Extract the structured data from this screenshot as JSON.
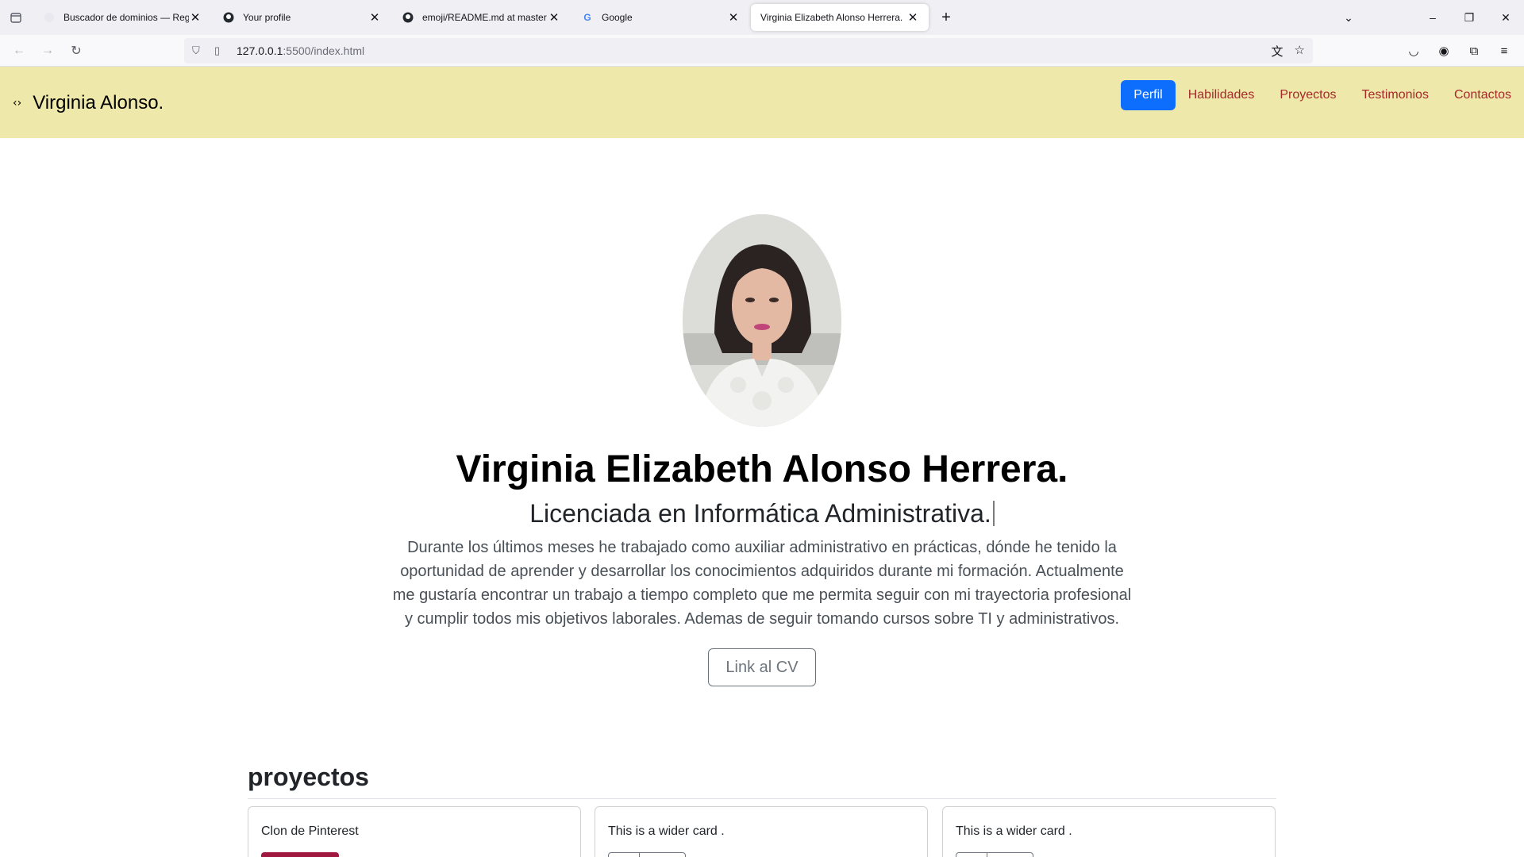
{
  "browser": {
    "tabs": [
      {
        "title": "Buscador de dominios — Regis",
        "icon": "globe-icon",
        "active": false
      },
      {
        "title": "Your profile",
        "icon": "github-icon",
        "active": false
      },
      {
        "title": "emoji/README.md at master · i",
        "icon": "github-icon",
        "active": false
      },
      {
        "title": "Google",
        "icon": "google-icon",
        "active": false
      },
      {
        "title": "Virginia Elizabeth Alonso Herrera.",
        "icon": "",
        "active": true
      }
    ],
    "url_host": "127.0.0.1",
    "url_path": ":5500/index.html"
  },
  "site": {
    "brand_name": "Virginia Alonso.",
    "brand_icon": "code-icon",
    "nav": [
      {
        "label": "Perfil",
        "active": true
      },
      {
        "label": "Habilidades",
        "active": false
      },
      {
        "label": "Proyectos",
        "active": false
      },
      {
        "label": "Testimonios",
        "active": false
      },
      {
        "label": "Contactos",
        "active": false
      }
    ],
    "nav_active_color": "#0d6efd",
    "nav_link_color": "#a52a2a",
    "header_bg": "#eee8aa"
  },
  "hero": {
    "name": "Virginia Elizabeth Alonso Herrera.",
    "subtitle": "Licenciada en Informática Administrativa.",
    "description": "Durante los últimos meses he trabajado como auxiliar administrativo en prácticas, dónde he tenido la oportunidad de aprender y desarrollar los conocimientos adquiridos durante mi formación. Actualmente me gustaría encontrar un trabajo a tiempo completo que me permita seguir con mi trayectoria profesional y cumplir todos mis objetivos laborales. Ademas de seguir tomando cursos sobre TI y administrativos.",
    "cv_button": "Link al CV"
  },
  "projects": {
    "title": "proyectos",
    "cards": [
      {
        "text": "Clon de Pinterest"
      },
      {
        "text": "This is a wider card ."
      },
      {
        "text": "This is a wider card ."
      }
    ]
  }
}
